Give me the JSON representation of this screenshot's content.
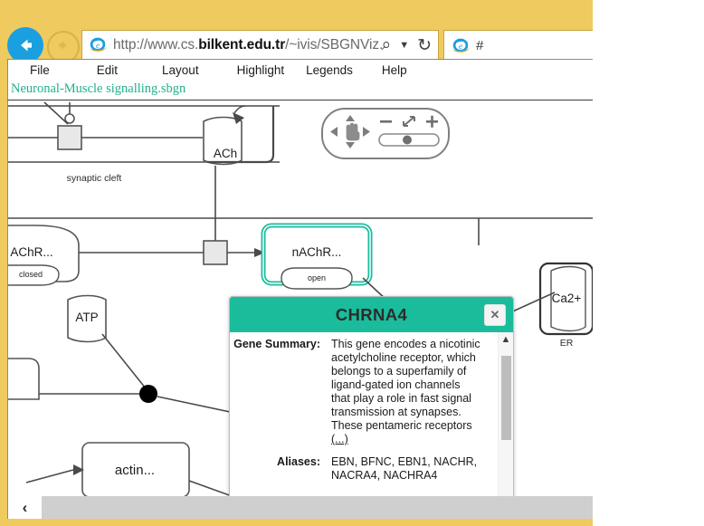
{
  "browser": {
    "back_icon": "back-arrow-icon",
    "forward_icon": "forward-arrow-icon",
    "url_prefix": "http://www.cs.",
    "url_domain": "bilkent.edu.tr",
    "url_suffix": "/~ivis/SBGNViz.as",
    "search_icon": "search-icon",
    "dropdown_icon": "chevron-down-icon",
    "refresh_icon": "refresh-icon",
    "tab_label": "#",
    "tab_favicon": "internet-explorer-icon"
  },
  "menu": {
    "items": [
      {
        "label": "File"
      },
      {
        "label": "Edit"
      },
      {
        "label": "Layout"
      },
      {
        "label": "Highlight"
      },
      {
        "label": "Legends"
      },
      {
        "label": "Help"
      }
    ]
  },
  "document": {
    "title": "Neuronal-Muscle signalling.sbgn",
    "title_color": "#22b08d"
  },
  "canvas": {
    "nodes": [
      {
        "id": "ach",
        "label": "ACh",
        "type": "simple-chemical"
      },
      {
        "id": "synaptic-cleft",
        "label": "synaptic cleft",
        "type": "compartment-label"
      },
      {
        "id": "nachr-closed",
        "label": "AChR...",
        "state": "closed",
        "type": "macromolecule"
      },
      {
        "id": "nachr-open",
        "label": "nAChR...",
        "state": "open",
        "type": "macromolecule",
        "selected": true
      },
      {
        "id": "atp",
        "label": "ATP",
        "type": "simple-chemical"
      },
      {
        "id": "actin",
        "label": "actin...",
        "type": "macromolecule"
      },
      {
        "id": "ca2plus",
        "label": "Ca2+",
        "type": "simple-chemical"
      },
      {
        "id": "er",
        "label": "ER",
        "type": "compartment-label"
      }
    ],
    "selection_color": "#1ABC9C"
  },
  "pan_widget": {
    "pan_icon": "hand-pan-icon",
    "up_icon": "chevron-up-icon",
    "down_icon": "chevron-down-icon",
    "left_icon": "chevron-left-icon",
    "right_icon": "chevron-right-icon",
    "zoom_out_label": "–",
    "zoom_fit_icon": "fit-to-screen-icon",
    "zoom_in_label": "+",
    "slider_value": 50
  },
  "popup": {
    "title": "CHRNA4",
    "header_color": "#1ABC9C",
    "close_icon": "close-icon",
    "scroll_up_icon": "chevron-up-icon",
    "rows": [
      {
        "key": "Gene Summary:",
        "value": "This gene encodes a nicotinic acetylcholine receptor, which belongs to a superfamily of ligand-gated ion channels that play a role in fast signal transmission at synapses. These pentameric receptors ",
        "more": "(...)"
      },
      {
        "key": "Aliases:",
        "value": "EBN, BFNC, EBN1, NACHR, NACRA4, NACHRA4",
        "more": ""
      }
    ]
  },
  "scrollbar": {
    "left_arrow": "‹"
  }
}
